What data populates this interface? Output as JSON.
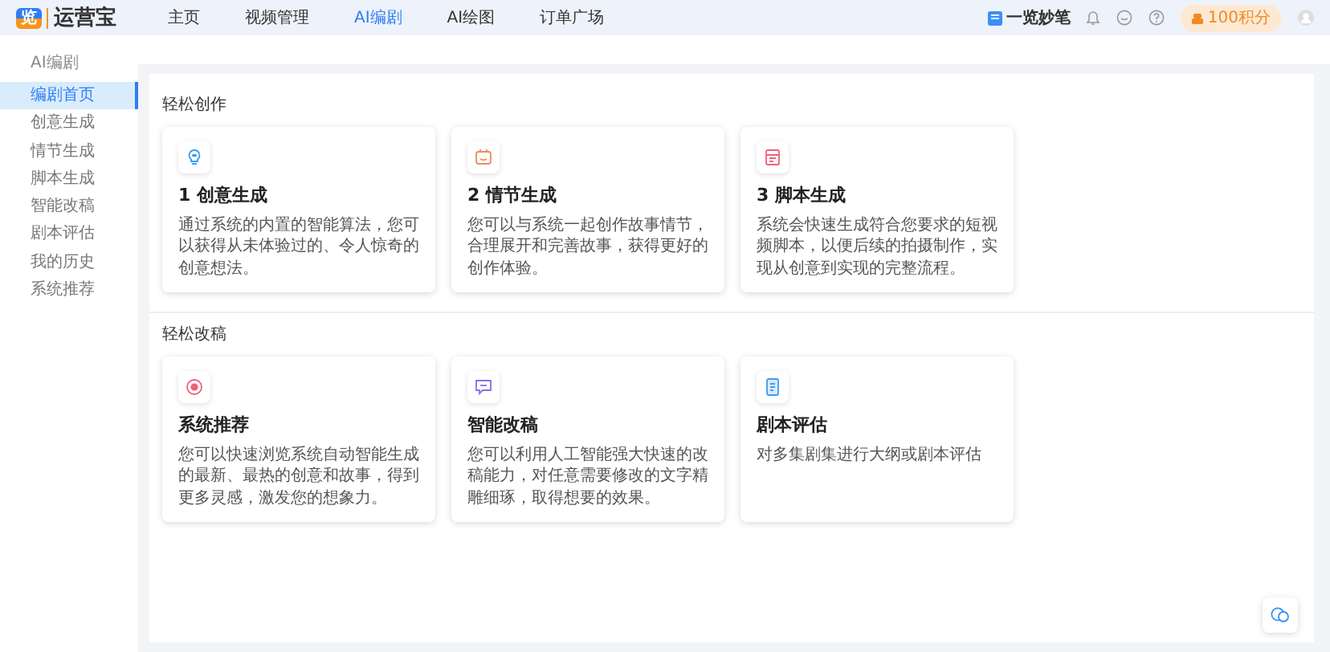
{
  "logo": {
    "mark": "览",
    "name": "运营宝"
  },
  "nav": [
    {
      "label": "主页",
      "selected": false
    },
    {
      "label": "视频管理",
      "selected": false
    },
    {
      "label": "AI编剧",
      "selected": true
    },
    {
      "label": "AI绘图",
      "selected": false
    },
    {
      "label": "订单广场",
      "selected": false
    }
  ],
  "toolbar": {
    "notes_link": "一览妙笔",
    "points_badge": "100积分"
  },
  "sidebar": {
    "title": "AI编剧",
    "items": [
      {
        "label": "编剧首页",
        "selected": true
      },
      {
        "label": "创意生成",
        "selected": false
      },
      {
        "label": "情节生成",
        "selected": false
      },
      {
        "label": "脚本生成",
        "selected": false
      },
      {
        "label": "智能改稿",
        "selected": false
      },
      {
        "label": "剧本评估",
        "selected": false
      },
      {
        "label": "我的历史",
        "selected": false
      },
      {
        "label": "系统推荐",
        "selected": false
      }
    ]
  },
  "sections": [
    {
      "title": "轻松创作",
      "cards": [
        {
          "kind": "bulb",
          "title": "1 创意生成",
          "description": "通过系统的内置的智能算法，您可以获得从未体验过的、令人惊奇的创意想法。"
        },
        {
          "kind": "smile",
          "title": "2 情节生成",
          "description": "您可以与系统一起创作故事情节，合理展开和完善故事，获得更好的创作体验。"
        },
        {
          "kind": "script",
          "title": "3 脚本生成",
          "description": "系统会快速生成符合您要求的短视频脚本，以便后续的拍摄制作，实现从创意到实现的完整流程。"
        }
      ]
    },
    {
      "title": "轻松改稿",
      "cards": [
        {
          "kind": "target",
          "title": "系统推荐",
          "description": "您可以快速浏览系统自动智能生成的最新、最热的创意和故事，得到更多灵感，激发您的想象力。"
        },
        {
          "kind": "edit",
          "title": "智能改稿",
          "description": "您可以利用人工智能强大快速的改稿能力，对任意需要修改的文字精雕细琢，取得想要的效果。"
        },
        {
          "kind": "doc",
          "title": "剧本评估",
          "description": "对多集剧集进行大纲或剧本评估"
        }
      ]
    }
  ]
}
